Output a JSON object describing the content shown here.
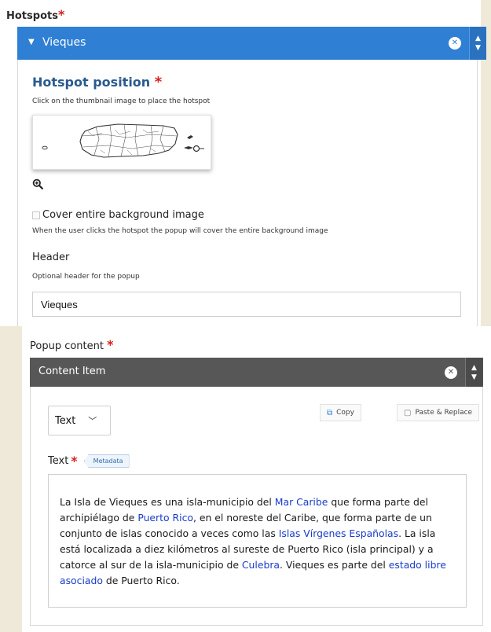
{
  "hotspots": {
    "label": "Hotspots",
    "item_title": "Vieques",
    "hotspot_position": {
      "title": "Hotspot position",
      "description": "Click on the thumbnail image to place the hotspot"
    },
    "cover": {
      "label": "Cover entire background image",
      "checked": false,
      "description": "When the user clicks the hotspot the popup will cover the entire background image"
    },
    "header": {
      "label": "Header",
      "description": "Optional header for the popup",
      "value": "Vieques"
    }
  },
  "popup": {
    "label": "Popup content",
    "item_title": "Content Item",
    "type_select": "Text",
    "copy_label": "Copy",
    "paste_label": "Paste & Replace",
    "text_label": "Text",
    "metadata_label": "Metadata",
    "text": {
      "s1": "La Isla de Vieques es una isla-municipio del ",
      "l1": "Mar Caribe",
      "s2": " que forma parte del archipiélago de ",
      "l2": "Puerto Rico",
      "s3": ", en el noreste del Caribe, que forma parte de un conjunto de islas conocido a veces como las ",
      "l3": "Islas Vírgenes Españolas",
      "s4": ". La isla está localizada a diez kilómetros al sureste de Puerto Rico (isla principal) y a catorce al sur de la isla-municipio de ",
      "l4": "Culebra",
      "s5": ". Vieques es parte del ",
      "l5": "estado libre asociado",
      "s6": " de Puerto Rico."
    }
  },
  "colors": {
    "accent_blue": "#2f7fd4",
    "content_bar": "#575757",
    "required": "#d9201d",
    "link": "#1a3cc8"
  }
}
